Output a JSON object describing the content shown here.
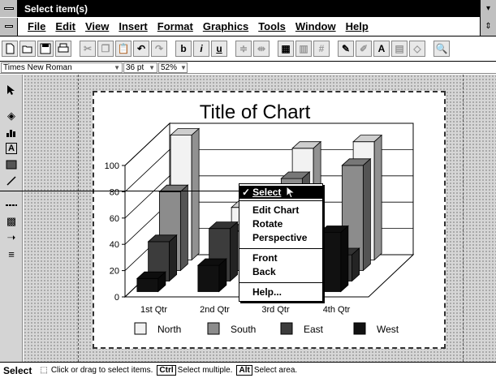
{
  "window": {
    "title": "Select item(s)"
  },
  "menubar": {
    "items": [
      {
        "label": "File"
      },
      {
        "label": "Edit"
      },
      {
        "label": "View"
      },
      {
        "label": "Insert"
      },
      {
        "label": "Format"
      },
      {
        "label": "Graphics"
      },
      {
        "label": "Tools"
      },
      {
        "label": "Window"
      },
      {
        "label": "Help"
      }
    ]
  },
  "toolbar": {
    "bold": "b",
    "italic": "i",
    "underline": "u"
  },
  "formatbar": {
    "font": "Times New Roman",
    "size": "36 pt",
    "zoom": "52%"
  },
  "context_menu": {
    "items": [
      {
        "label": "Select",
        "checked": "✓"
      },
      {
        "label": "Edit Chart"
      },
      {
        "label": "Rotate"
      },
      {
        "label": "Perspective"
      },
      {
        "label": "Front"
      },
      {
        "label": "Back"
      },
      {
        "label": "Help..."
      }
    ]
  },
  "status": {
    "mode": "Select",
    "text1": "Click or drag to select items.",
    "key1": "Ctrl",
    "text2": "Select multiple.",
    "key2": "Alt",
    "text3": "Select area."
  },
  "chart_data": {
    "type": "bar",
    "title": "Title of Chart",
    "categories": [
      "1st Qtr",
      "2nd Qtr",
      "3rd Qtr",
      "4th Qtr"
    ],
    "ylim": [
      0,
      100
    ],
    "yticks": [
      "0",
      "20",
      "40",
      "60",
      "80",
      "100"
    ],
    "series": [
      {
        "name": "North",
        "color": "#f2f2f2",
        "values": [
          95,
          40,
          85,
          90
        ]
      },
      {
        "name": "South",
        "color": "#8c8c8c",
        "values": [
          60,
          30,
          70,
          80
        ]
      },
      {
        "name": "East",
        "color": "#3c3c3c",
        "values": [
          30,
          40,
          60,
          20
        ]
      },
      {
        "name": "West",
        "color": "#111111",
        "values": [
          10,
          20,
          30,
          45
        ]
      }
    ],
    "grid": true,
    "legend": "bottom"
  }
}
